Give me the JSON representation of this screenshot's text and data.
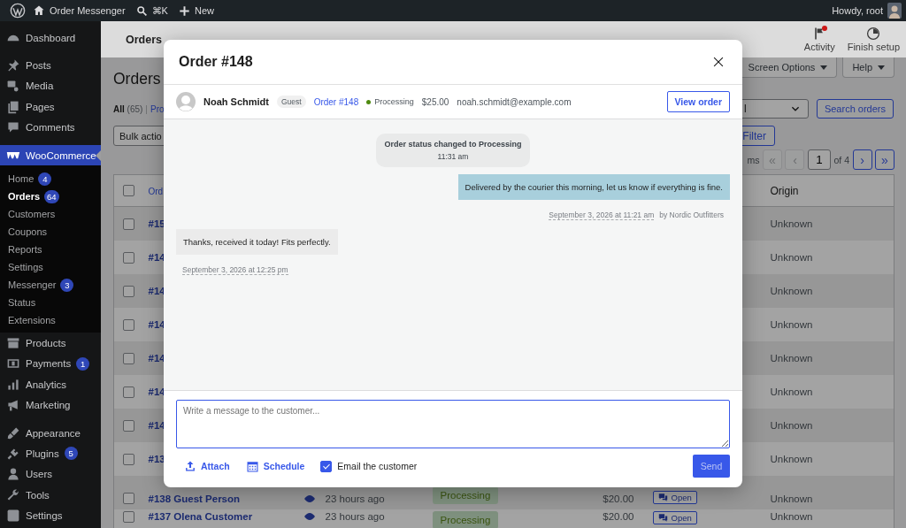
{
  "admin_bar": {
    "site_name": "Order Messenger",
    "search_shortcut": "⌘K",
    "new_label": "New",
    "greeting": "Howdy, root"
  },
  "sidebar": {
    "groups": [
      [
        {
          "label": "Dashboard",
          "selected": false
        }
      ],
      [
        {
          "label": "Posts",
          "selected": false
        },
        {
          "label": "Media",
          "selected": false
        },
        {
          "label": "Pages",
          "selected": false
        },
        {
          "label": "Comments",
          "selected": false
        }
      ],
      [
        {
          "label": "WooCommerce",
          "selected": true,
          "children": [
            {
              "label": "Home",
              "badge": "4",
              "selected": false
            },
            {
              "label": "Orders",
              "badge": "64",
              "selected": true
            },
            {
              "label": "Customers",
              "selected": false
            },
            {
              "label": "Coupons",
              "selected": false
            },
            {
              "label": "Reports",
              "selected": false
            },
            {
              "label": "Settings",
              "selected": false
            },
            {
              "label": "Messenger",
              "badge": "3",
              "selected": false
            },
            {
              "label": "Status",
              "selected": false
            },
            {
              "label": "Extensions",
              "selected": false
            }
          ]
        },
        {
          "label": "Products",
          "selected": false
        },
        {
          "label": "Payments",
          "badge": "1",
          "selected": false
        },
        {
          "label": "Analytics",
          "selected": false
        },
        {
          "label": "Marketing",
          "selected": false
        }
      ],
      [
        {
          "label": "Appearance",
          "selected": false
        },
        {
          "label": "Plugins",
          "badge": "5",
          "selected": false
        },
        {
          "label": "Users",
          "selected": false
        },
        {
          "label": "Tools",
          "selected": false
        },
        {
          "label": "Settings",
          "selected": false
        }
      ]
    ]
  },
  "header": {
    "title": "Orders",
    "actions": [
      {
        "label": "Activity",
        "notification": true
      },
      {
        "label": "Finish setup",
        "notification": false
      }
    ]
  },
  "screen_meta": [
    "Screen Options",
    "Help"
  ],
  "page": {
    "title": "Orders",
    "views": [
      {
        "label": "All",
        "count": "(65)",
        "selected": true
      },
      {
        "label": "Pro",
        "selected": false
      }
    ],
    "view_separator": "|",
    "status_select": "l",
    "search_button": "Search orders",
    "bulk_select": "Bulk actio",
    "filter_button": "Filter",
    "pagination": {
      "items_text": "ms",
      "prev": [
        {
          "label": "«",
          "disabled": true
        },
        {
          "label": "‹",
          "disabled": true
        }
      ],
      "current_page": "1",
      "total_text": "of 4",
      "next": [
        {
          "label": "›",
          "disabled": false
        },
        {
          "label": "»",
          "disabled": false
        }
      ]
    }
  },
  "table": {
    "select_all_checked": false,
    "columns": {
      "order": "Ord",
      "origin": "Origin"
    },
    "rows": [
      {
        "order": "#15",
        "origin": "Unknown",
        "checked": false
      },
      {
        "order": "#14",
        "origin": "Unknown",
        "checked": false
      },
      {
        "order": "#14",
        "origin": "Unknown",
        "checked": false
      },
      {
        "order": "#14",
        "origin": "Unknown",
        "checked": false
      },
      {
        "order": "#14",
        "origin": "Unknown",
        "checked": false
      },
      {
        "order": "#14",
        "origin": "Unknown",
        "checked": false
      },
      {
        "order": "#14",
        "origin": "Unknown",
        "checked": false
      },
      {
        "order": "#13",
        "origin": "Unknown",
        "checked": false
      },
      {
        "order": "#138 Guest Person",
        "preview": true,
        "date": "23 hours ago",
        "status": "Processing",
        "total": "$20.00",
        "messages": "Open",
        "origin": "Unknown",
        "checked": false
      },
      {
        "order": "#137 Olena Customer",
        "preview": true,
        "date": "23 hours ago",
        "status": "Processing",
        "total": "$20.00",
        "messages": "Open",
        "origin": "Unknown",
        "checked": false
      }
    ]
  },
  "modal": {
    "title": "Order #148",
    "customer": {
      "name": "Noah Schmidt",
      "tag": "Guest",
      "order_link": "Order #148",
      "status": "Processing",
      "total": "$25.00",
      "email": "noah.schmidt@example.com"
    },
    "view_button": "View order",
    "messages": [
      {
        "kind": "system",
        "text": "Order status changed to Processing",
        "time": "11:31 am"
      },
      {
        "kind": "outgoing",
        "text": "Delivered by the courier this morning, let us know if everything is fine.",
        "time": "September 3, 2026 at 11:21 am",
        "author": "by Nordic Outfitters"
      },
      {
        "kind": "incoming",
        "text": "Thanks, received it today! Fits perfectly.",
        "time": "September 3, 2026 at 12:25 pm"
      }
    ],
    "composer": {
      "placeholder": "Write a message to the customer...",
      "attach": "Attach",
      "schedule": "Schedule",
      "email_label": "Email the customer",
      "email_checked": true,
      "send": "Send",
      "send_disabled": true
    }
  }
}
